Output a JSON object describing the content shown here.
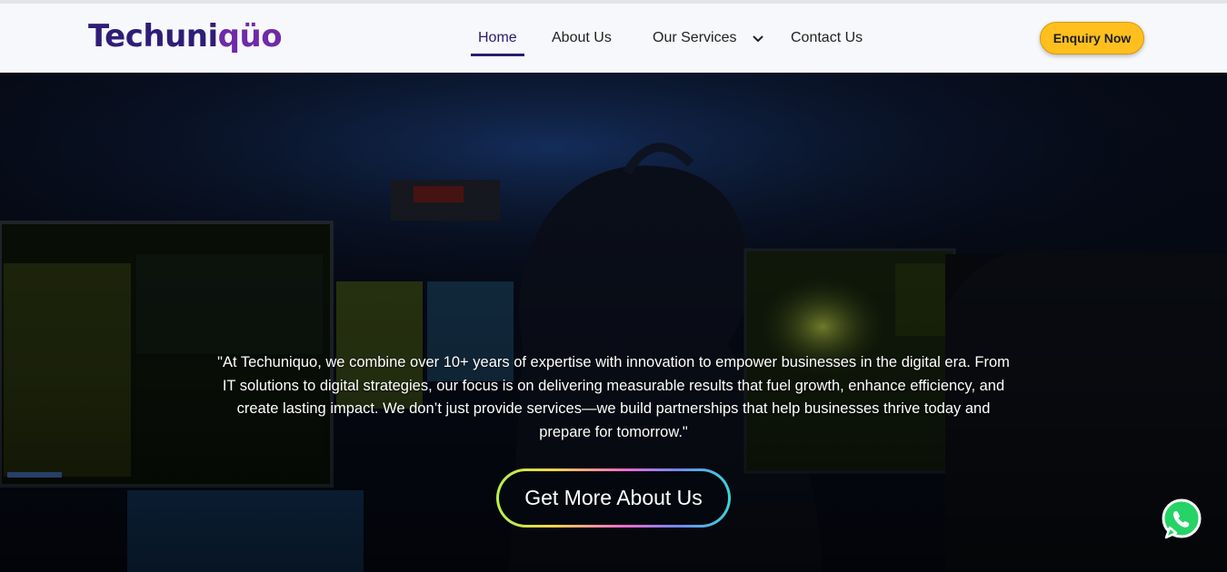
{
  "brand": {
    "logo_text_main": "Techuni",
    "logo_text_tail": "qüo",
    "colors": {
      "primary": "#2f1d77",
      "accent": "#6f2aa8",
      "dots": "#e0263d"
    }
  },
  "nav": {
    "items": [
      {
        "label": "Home",
        "active": true
      },
      {
        "label": "About Us",
        "active": false
      },
      {
        "label": "Our Services",
        "active": false,
        "has_dropdown": true
      },
      {
        "label": "Contact Us",
        "active": false
      }
    ],
    "dropdown_icon": "chevron-down-icon"
  },
  "header": {
    "cta_label": "Enquiry Now",
    "cta_color": "#ffbf1f"
  },
  "hero": {
    "text": "\"At Techuniquo, we combine over 10+ years of expertise with innovation to empower businesses in the digital era. From IT solutions to digital strategies, our focus is on delivering measurable results that fuel growth, enhance efficiency, and create lasting impact. We don’t just provide services—we build partnerships that help businesses thrive today and prepare for tomorrow.\"",
    "cta_label": "Get More About Us"
  },
  "floating": {
    "whatsapp_icon": "whatsapp-icon",
    "color": "#25d366"
  }
}
